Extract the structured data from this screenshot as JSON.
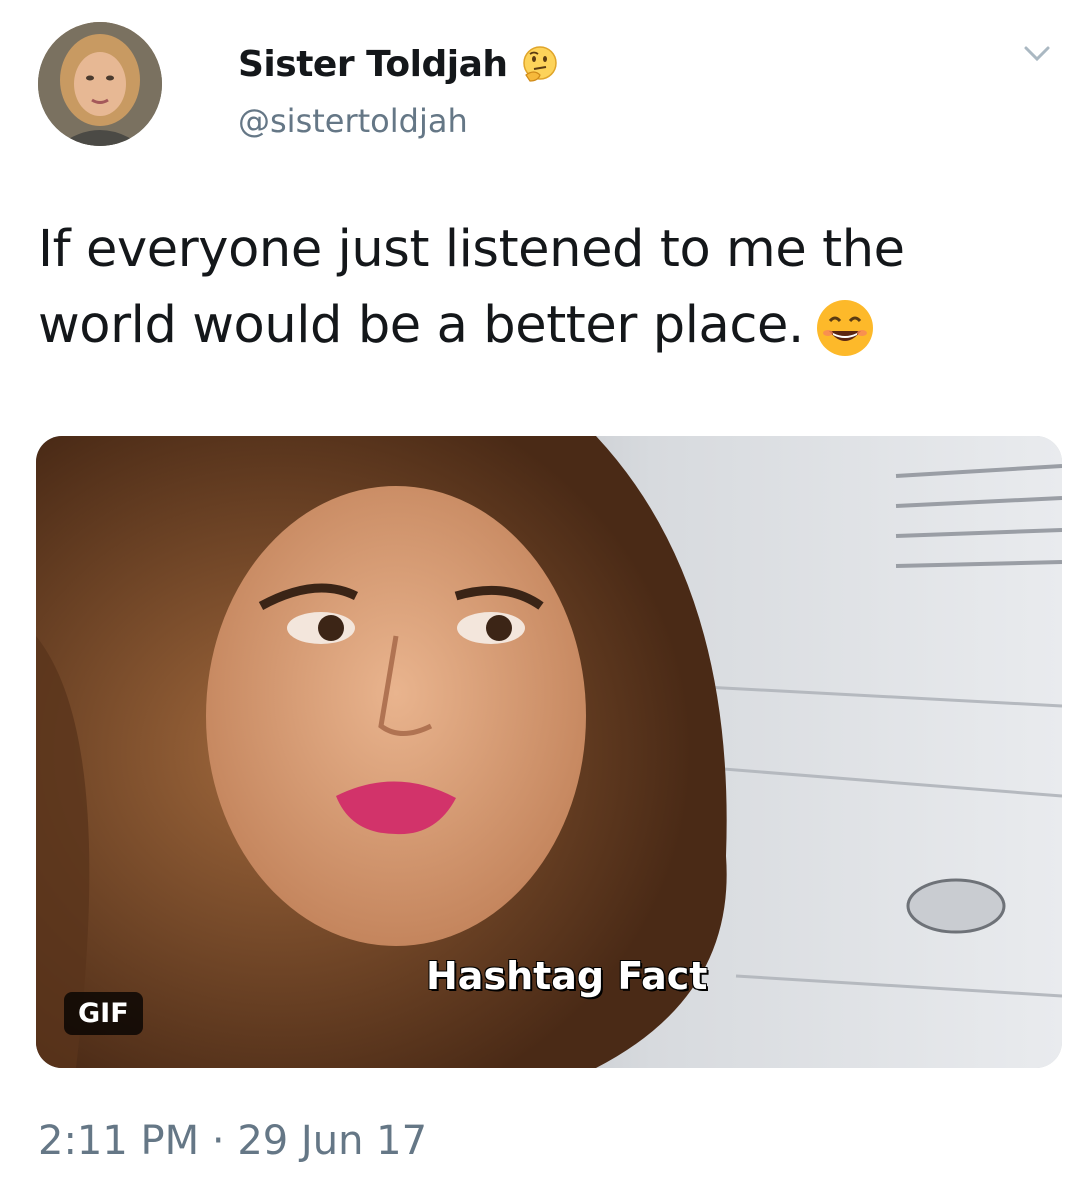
{
  "tweet": {
    "author_name": "Sister Toldjah",
    "author_handle": "@sistertoldjah",
    "name_emoji_icon": "thinking-face-icon",
    "text": "If everyone just listened to me the world would be a better place.",
    "text_emoji_icon": "grinning-face-icon",
    "media": {
      "caption": "Hashtag Fact",
      "badge": "GIF"
    },
    "timestamp": "2:11 PM · 29 Jun 17"
  },
  "colors": {
    "text": "#14171a",
    "secondary": "#657786"
  }
}
